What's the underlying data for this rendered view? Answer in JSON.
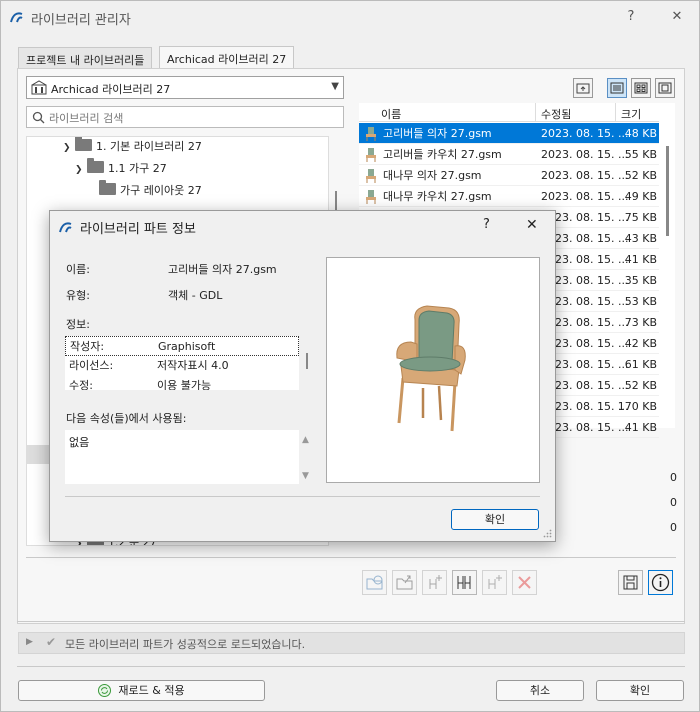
{
  "window": {
    "title": "라이브러리 관리자",
    "help": "?",
    "close": "✕"
  },
  "tabs": [
    {
      "label": "프로젝트 내 라이브러리들",
      "active": false
    },
    {
      "label": "Archicad 라이브러리 27",
      "active": true
    }
  ],
  "library_select": {
    "value": "Archicad 라이브러리 27"
  },
  "search": {
    "placeholder": "라이브러리 검색"
  },
  "tree": {
    "items": [
      {
        "label": "1. 기본 라이브러리 27",
        "level": 1,
        "expanded": true
      },
      {
        "label": "1.1 가구 27",
        "level": 2,
        "expanded": true
      },
      {
        "label": "가구 레이아웃 27",
        "level": 3,
        "expanded": false
      },
      {
        "label": "1.2 문 27",
        "level": 2,
        "expanded": false
      }
    ]
  },
  "list": {
    "columns": [
      "이름",
      "수정됨",
      "크기"
    ],
    "rows": [
      {
        "name": "고리버들 의자 27.gsm",
        "date": "2023. 08. 15. ...",
        "size": "48 KB",
        "selected": true
      },
      {
        "name": "고리버들 카우치 27.gsm",
        "date": "2023. 08. 15. ...",
        "size": "55 KB",
        "selected": false
      },
      {
        "name": "대나무 의자 27.gsm",
        "date": "2023. 08. 15. ...",
        "size": "52 KB",
        "selected": false
      },
      {
        "name": "대나무 카우치 27.gsm",
        "date": "2023. 08. 15. ...",
        "size": "49 KB",
        "selected": false
      },
      {
        "name": "",
        "date": "2023. 08. 15. ...",
        "size": "75 KB",
        "selected": false
      },
      {
        "name": "",
        "date": "2023. 08. 15. ...",
        "size": "43 KB",
        "selected": false
      },
      {
        "name": "",
        "date": "2023. 08. 15. ...",
        "size": "41 KB",
        "selected": false
      },
      {
        "name": "",
        "date": "2023. 08. 15. ...",
        "size": "35 KB",
        "selected": false
      },
      {
        "name": "",
        "date": "2023. 08. 15. ...",
        "size": "53 KB",
        "selected": false
      },
      {
        "name": "",
        "date": "2023. 08. 15. ...",
        "size": "73 KB",
        "selected": false
      },
      {
        "name": "",
        "date": "2023. 08. 15. ...",
        "size": "42 KB",
        "selected": false
      },
      {
        "name": "",
        "date": "2023. 08. 15. ...",
        "size": "61 KB",
        "selected": false
      },
      {
        "name": "",
        "date": "2023. 08. 15. ...",
        "size": "52 KB",
        "selected": false
      },
      {
        "name": "",
        "date": "2023. 08. 15. ...",
        "size": "170 KB",
        "selected": false
      },
      {
        "name": "",
        "date": "2023. 08. 15. ...",
        "size": "41 KB",
        "selected": false
      }
    ]
  },
  "counts": [
    "0",
    "0",
    "0"
  ],
  "status": {
    "message": "모든 라이브러리 파트가 성공적으로 로드되었습니다."
  },
  "footer": {
    "reload": "재로드 & 적용",
    "cancel": "취소",
    "ok": "확인"
  },
  "dialog": {
    "title": "라이브러리 파트 정보",
    "help": "?",
    "close": "✕",
    "name_label": "이름:",
    "name_value": "고리버들 의자 27.gsm",
    "type_label": "유형:",
    "type_value": "객체 - GDL",
    "info_label": "정보:",
    "info_rows": [
      {
        "key": "작성자:",
        "value": "Graphisoft"
      },
      {
        "key": "라이선스:",
        "value": "저작자표시 4.0"
      },
      {
        "key": "수정:",
        "value": "이용 불가능"
      }
    ],
    "used_label": "다음 속성(들)에서 사용됨:",
    "used_value": "없음",
    "ok": "확인"
  },
  "colors": {
    "accent": "#0078d7",
    "chair_cushion": "#7a9a84",
    "chair_frame": "#d7a877"
  }
}
